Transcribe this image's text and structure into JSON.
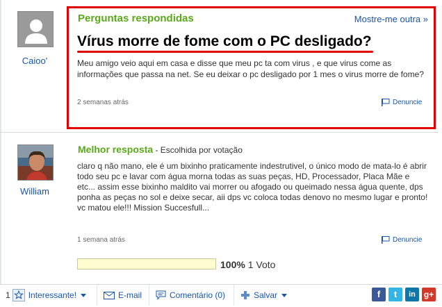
{
  "question": {
    "username": "Caioo'",
    "section_title": "Perguntas respondidas",
    "more_link": "Mostre-me outra",
    "more_arrow": "»",
    "title": "Vírus morre de fome com o PC desligado?",
    "body": "Meu amigo veio aqui em casa e disse que meu pc ta com virus , e que virus come as informações que passa na net. Se eu deixar o pc desligado por 1 mes o virus morre de fome?",
    "time": "2 semanas atrás",
    "report_label": "Denuncie"
  },
  "answer": {
    "username": "William",
    "best_label": "Melhor resposta",
    "chosen_label": " - Escolhida por votação",
    "body": "claro q não mano, ele é um bixinho praticamente indestrutivel, o único modo de mata-lo é abrir todo seu pc e lavar com água morna todas as suas peças, HD, Processador, Placa Mãe e etc... assim esse bixinho maldito vai morrer ou afogado ou queimado nessa água quente, dps ponha as peças no sol e deixe secar, aii dps vc coloca todas denovo no mesmo lugar e pronto! vc matou ele!!! Mission Succesfull...",
    "time": "1 semana atrás",
    "report_label": "Denuncie",
    "vote_percent_label": "100%",
    "vote_fraction": 1.0,
    "vote_count_label": "1 Voto"
  },
  "toolbar": {
    "interesting_count": "1",
    "interesting_label": "Interessante!",
    "email_label": "E-mail",
    "comment_label": "Comentário (0)",
    "save_label": "Salvar",
    "social": [
      {
        "name": "facebook",
        "glyph": "f",
        "color": "#3b5998"
      },
      {
        "name": "twitter",
        "glyph": "t",
        "color": "#33b5e5"
      },
      {
        "name": "linkedin",
        "glyph": "in",
        "color": "#0e76a8"
      },
      {
        "name": "google-plus",
        "glyph": "g+",
        "color": "#d3392b"
      }
    ]
  },
  "colors": {
    "accent_green": "#5aa91a",
    "link_blue": "#1a56a6",
    "highlight_red": "#e00000"
  }
}
